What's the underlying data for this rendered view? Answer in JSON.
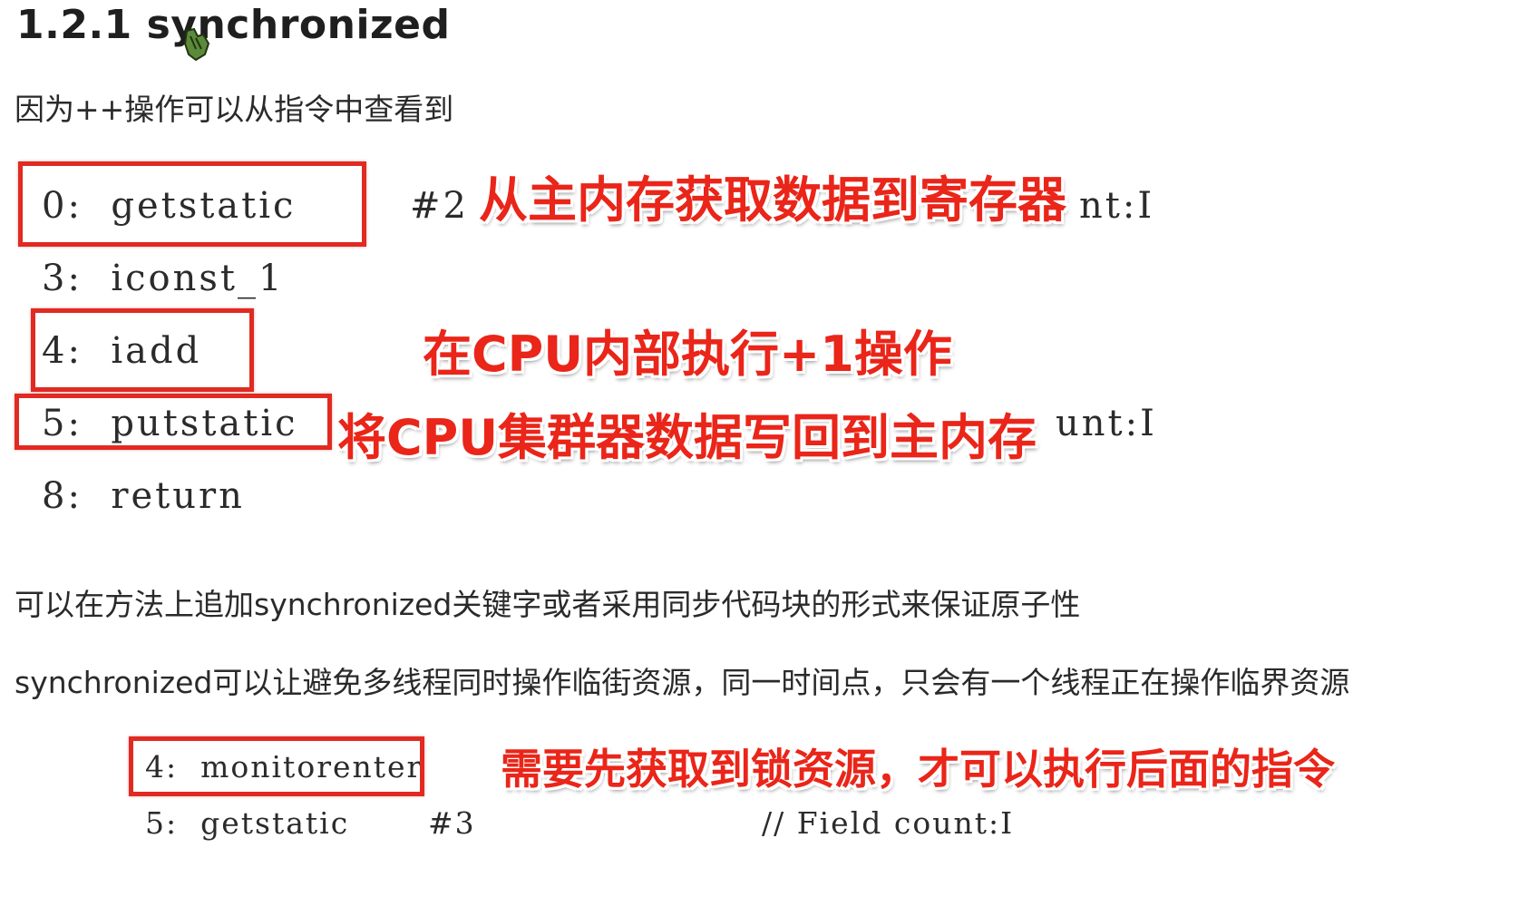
{
  "heading": "1.2.1 synchronized",
  "intro": "因为++操作可以从指令中查看到",
  "bytecode": [
    {
      "instr": "0:  getstatic",
      "ref": "#2",
      "tail": "nt:I"
    },
    {
      "instr": "3:  iconst_1"
    },
    {
      "instr": "4:  iadd"
    },
    {
      "instr": "5:  putstatic",
      "tail": "unt:I"
    },
    {
      "instr": "8:  return"
    }
  ],
  "annotations": {
    "fetch": "从主内存获取数据到寄存器",
    "add": "在CPU内部执行+1操作",
    "write": "将CPU集群器数据写回到主内存",
    "lock": "需要先获取到锁资源，才可以执行后面的指令"
  },
  "paragraphs": {
    "p1": "可以在方法上追加synchronized关键字或者采用同步代码块的形式来保证原子性",
    "p2": "synchronized可以让避免多线程同时操作临街资源，同一时间点，只会有一个线程正在操作临界资源"
  },
  "monitor_code": [
    {
      "instr": "4:  monitorenter"
    },
    {
      "instr": "5:  getstatic",
      "ref": "#3",
      "comment": "// Field count:I"
    }
  ],
  "colors": {
    "highlight_box": "#e02a22",
    "annotation_text": "#ea2519"
  },
  "icons": {
    "cursor": "hand-cursor-icon"
  }
}
